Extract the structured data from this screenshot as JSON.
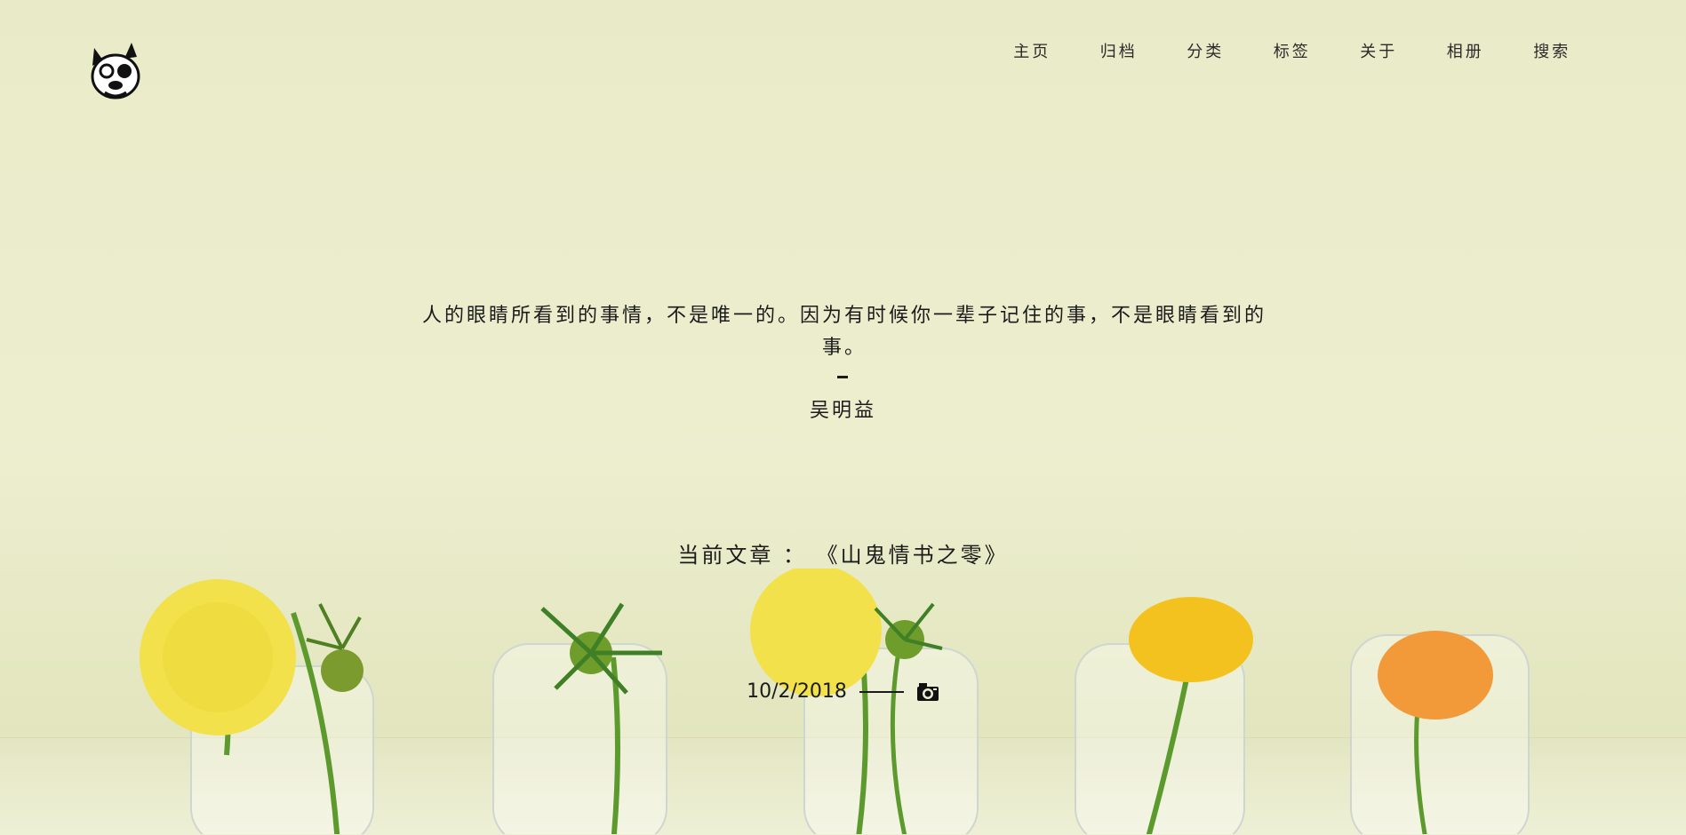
{
  "nav": {
    "items": [
      {
        "label": "主页"
      },
      {
        "label": "归档"
      },
      {
        "label": "分类"
      },
      {
        "label": "标签"
      },
      {
        "label": "关于"
      },
      {
        "label": "相册"
      },
      {
        "label": "搜索"
      }
    ]
  },
  "logo": {
    "icon": "dog-face-icon"
  },
  "quote": {
    "text": "人的眼睛所看到的事情，不是唯一的。因为有时候你一辈子记住的事，不是眼睛看到的事。",
    "author": "吴明益"
  },
  "current_article": {
    "prefix": "当前文章 ：",
    "title": "《山鬼情书之零》"
  },
  "meta": {
    "date": "10/2/2018",
    "icon": "camera-icon"
  },
  "colors": {
    "background": "#eceecf",
    "text": "#1b1b1b",
    "flower_yellow": "#f2e14a",
    "flower_gold": "#f4c21f",
    "flower_orange": "#f29a3a",
    "stem": "#5d9a2e"
  }
}
